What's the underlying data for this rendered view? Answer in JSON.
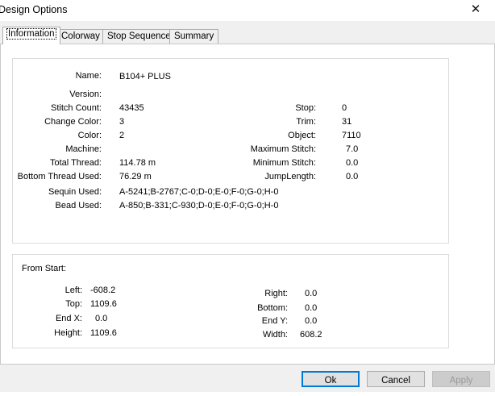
{
  "window": {
    "title": "Design Options",
    "close_glyph": "✕"
  },
  "tabs": [
    {
      "label": "Information",
      "active": true
    },
    {
      "label": "Colorway",
      "active": false
    },
    {
      "label": "Stop Sequence",
      "active": false
    },
    {
      "label": "Summary",
      "active": false
    }
  ],
  "info": {
    "name_label": "Name:",
    "name": "B104+ PLUS",
    "version_label": "Version:",
    "version": "",
    "stitch_count_label": "Stitch Count:",
    "stitch_count": "43435",
    "change_color_label": "Change Color:",
    "change_color": "3",
    "color_label": "Color:",
    "color": "2",
    "machine_label": "Machine:",
    "machine": "",
    "total_thread_label": "Total Thread:",
    "total_thread": "114.78 m",
    "bottom_thread_label": "Bottom Thread Used:",
    "bottom_thread": "76.29 m",
    "sequin_label": "Sequin Used:",
    "sequin": "A-5241;B-2767;C-0;D-0;E-0;F-0;G-0;H-0",
    "bead_label": "Bead Used:",
    "bead": "A-850;B-331;C-930;D-0;E-0;F-0;G-0;H-0",
    "stop_label": "Stop:",
    "stop": "0",
    "trim_label": "Trim:",
    "trim": "31",
    "object_label": "Object:",
    "object": "7110",
    "max_stitch_label": "Maximum Stitch:",
    "max_stitch": "7.0",
    "min_stitch_label": "Minimum Stitch:",
    "min_stitch": "0.0",
    "jump_length_label": "JumpLength:",
    "jump_length": "0.0"
  },
  "from_start": {
    "title": "From Start:",
    "left_label": "Left:",
    "left": "-608.2",
    "top_label": "Top:",
    "top": "1109.6",
    "endx_label": "End X:",
    "endx": "0.0",
    "height_label": "Height:",
    "height": "1109.6",
    "right_label": "Right:",
    "right": "0.0",
    "bottom_label": "Bottom:",
    "bottom": "0.0",
    "endy_label": "End Y:",
    "endy": "0.0",
    "width_label": "Width:",
    "width": "608.2"
  },
  "buttons": {
    "ok": "Ok",
    "cancel": "Cancel",
    "apply": "Apply"
  }
}
